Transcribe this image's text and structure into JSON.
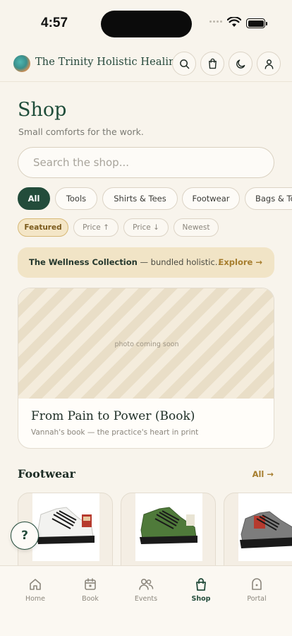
{
  "status_bar": {
    "time": "4:57"
  },
  "header": {
    "brand_name": "The Trinity Holistic Healing"
  },
  "page": {
    "title": "Shop",
    "subtitle": "Small comforts for the work."
  },
  "search": {
    "placeholder": "Search the shop..."
  },
  "categories": [
    "All",
    "Tools",
    "Shirts & Tees",
    "Footwear",
    "Bags & Totes"
  ],
  "sort_options": [
    "Featured",
    "Price ↑",
    "Price ↓",
    "Newest"
  ],
  "banner": {
    "title": "The Wellness Collection",
    "description": " — bundled holistic…",
    "link": "Explore →"
  },
  "featured": {
    "photo_label": "photo coming soon",
    "title": "From Pain to Power (Book)",
    "subtitle": "Vannah's book — the practice's heart in print"
  },
  "footwear": {
    "title": "Footwear",
    "link": "All →",
    "products": [
      {
        "colorway": "white",
        "accent": "#f2f2f0"
      },
      {
        "colorway": "green",
        "accent": "#4f7a3a"
      },
      {
        "colorway": "gray",
        "accent": "#7d7d7d"
      }
    ]
  },
  "help": {
    "label": "?"
  },
  "tabs": [
    "Home",
    "Book",
    "Events",
    "Shop",
    "Portal"
  ],
  "colors": {
    "accent": "#234c3b",
    "gold": "#a67d2d",
    "background": "#f8f4ec"
  }
}
